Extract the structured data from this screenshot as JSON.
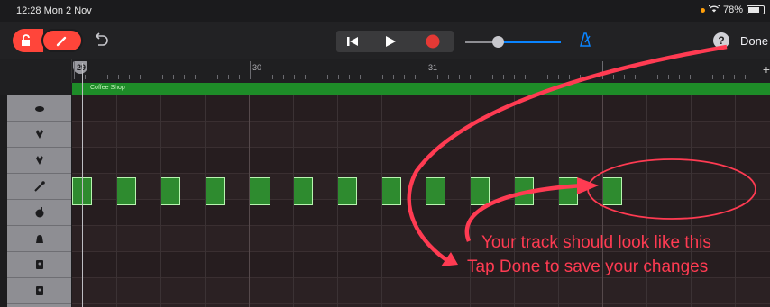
{
  "status_bar": {
    "time": "12:28  Mon 2 Nov",
    "battery": "78%"
  },
  "toolbar": {
    "done_label": "Done",
    "help_label": "?"
  },
  "ruler": {
    "bars": [
      "29",
      "30",
      "31"
    ],
    "plus_label": "+"
  },
  "region": {
    "name": "Coffee Shop"
  },
  "instruments": [
    {
      "icon": "shaker-icon"
    },
    {
      "icon": "hand-clap-icon"
    },
    {
      "icon": "hand-clap-icon"
    },
    {
      "icon": "drumstick-icon"
    },
    {
      "icon": "tambourine-icon"
    },
    {
      "icon": "bell-icon"
    },
    {
      "icon": "cajon-icon"
    },
    {
      "icon": "cajon-icon"
    }
  ],
  "annotation": {
    "line1": "Your track should look like this",
    "line2": "Tap Done to save your changes",
    "color": "#ff3b52"
  },
  "colors": {
    "record": "#e53935",
    "accent": "#ff453a",
    "region": "#1e8c28",
    "note": "#2e8b2f"
  }
}
